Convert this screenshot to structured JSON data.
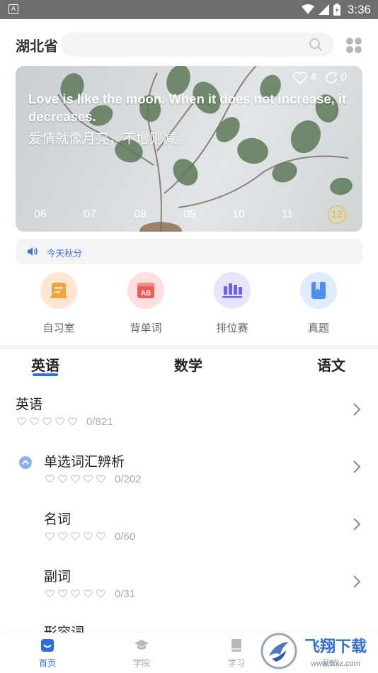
{
  "status_bar": {
    "time": "3:36",
    "left_icon_letter": "A"
  },
  "header": {
    "province": "湖北省",
    "search_placeholder": ""
  },
  "banner": {
    "likes": "4",
    "shares": "0",
    "quote_en": "Love is like the moon. When it does not increase, it decreases.",
    "quote_zh": "爱情就像月亮，不增则减。",
    "dates": [
      "06",
      "07",
      "08",
      "09",
      "10",
      "11",
      "12"
    ],
    "active_date": "12"
  },
  "notice": {
    "text": "今天秋分"
  },
  "features": [
    {
      "label": "自习室",
      "icon": "study-room-icon",
      "bg": "#fde7d3",
      "color": "#f2a33c"
    },
    {
      "label": "背单词",
      "icon": "vocabulary-icon",
      "bg": "#fde0df",
      "color": "#ef5d5a",
      "badge": "AB"
    },
    {
      "label": "排位赛",
      "icon": "ranking-icon",
      "bg": "#e6e5fb",
      "color": "#6c63e8"
    },
    {
      "label": "真题",
      "icon": "exam-papers-icon",
      "bg": "#e0ecfc",
      "color": "#4a8ef0"
    }
  ],
  "tabs": {
    "english": "英语",
    "math": "数学",
    "chinese": "语文",
    "active": "英语"
  },
  "list": [
    {
      "title": "英语",
      "count": "0/821"
    },
    {
      "title": "单选词汇辨析",
      "count": "0/202"
    },
    {
      "title": "名词",
      "count": "0/60"
    },
    {
      "title": "副词",
      "count": "0/31"
    },
    {
      "title": "形容词"
    }
  ],
  "bottom_nav": {
    "home": "首页",
    "academy": "学院",
    "study": "学习",
    "mine": "我的"
  },
  "watermark": {
    "text": "飞翔下载",
    "url": "www.fxxz.com"
  },
  "colors": {
    "accent": "#2f6de0",
    "active_date": "#f2c100"
  }
}
